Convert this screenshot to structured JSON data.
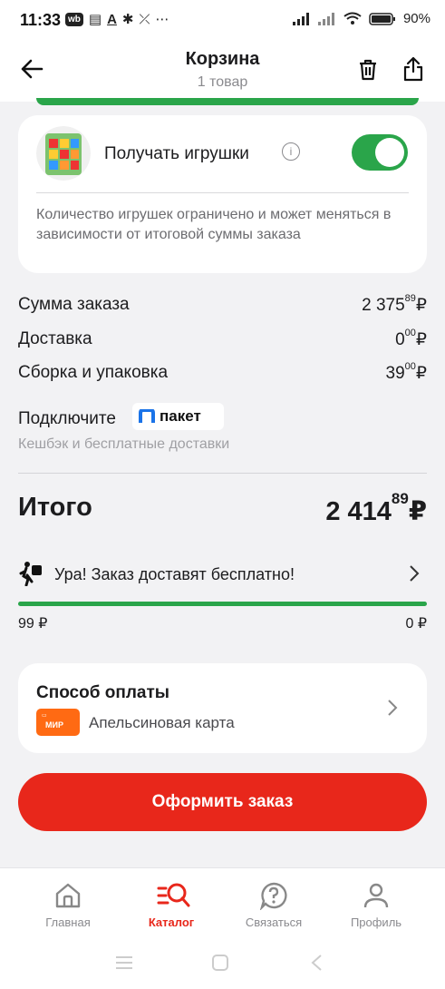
{
  "status_bar": {
    "time": "11:33",
    "app_icon": "wb",
    "letter": "A",
    "battery": "90%"
  },
  "header": {
    "title": "Корзина",
    "subtitle": "1 товар"
  },
  "toys": {
    "label": "Получать игрушки",
    "info_icon": "i",
    "toggle_on": true,
    "note": "Количество игрушек ограничено и может меняться в зависимости от итоговой суммы заказа"
  },
  "summary": {
    "rows": [
      {
        "label": "Сумма заказа",
        "int": "2 375",
        "dec": "89",
        "cur": "₽"
      },
      {
        "label": "Доставка",
        "int": "0",
        "dec": "00",
        "cur": "₽"
      },
      {
        "label": "Сборка и упаковка",
        "int": "39",
        "dec": "00",
        "cur": "₽"
      }
    ]
  },
  "paket": {
    "text": "Подключите",
    "badge": "пакет",
    "subtext": "Кешбэк и бесплатные доставки"
  },
  "total": {
    "label": "Итого",
    "int": "2 414",
    "dec": "89",
    "cur": "₽"
  },
  "free_delivery": {
    "text": "Ура! Заказ доставят бесплатно!",
    "progress": 1.0,
    "left": "99 ₽",
    "right": "0 ₽"
  },
  "payment": {
    "title": "Способ оплаты",
    "card_name": "Апельсиновая карта",
    "card_brand": "МИР"
  },
  "order_button": {
    "label": "Оформить заказ"
  },
  "colors": {
    "accent": "#e8271b",
    "green": "#2aa54a"
  },
  "bottom_nav": [
    {
      "label": "Главная",
      "icon": "home-icon",
      "active": false
    },
    {
      "label": "Каталог",
      "icon": "catalog-search-icon",
      "active": true
    },
    {
      "label": "Связаться",
      "icon": "help-icon",
      "active": false
    },
    {
      "label": "Профиль",
      "icon": "profile-icon",
      "active": false
    }
  ]
}
